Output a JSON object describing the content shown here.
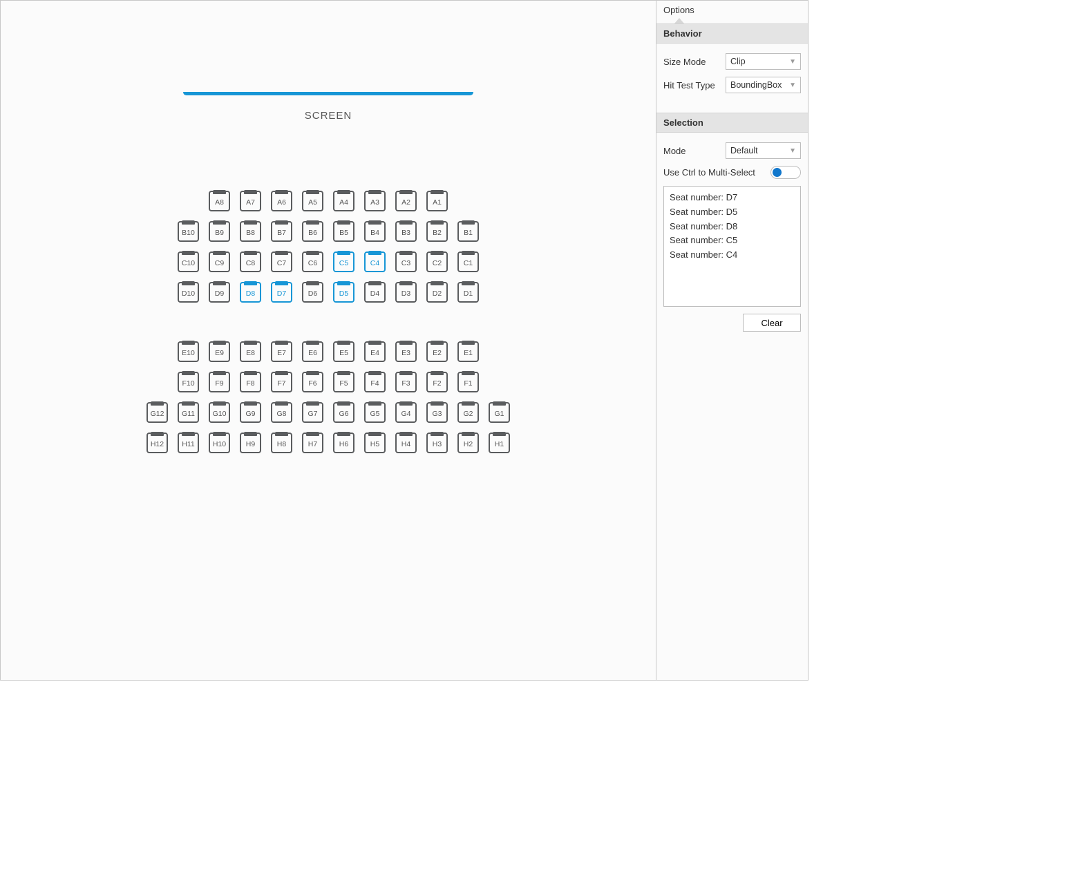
{
  "screen_label": "SCREEN",
  "rows": [
    {
      "seats": [
        "A8",
        "A7",
        "A6",
        "A5",
        "A4",
        "A3",
        "A2",
        "A1"
      ],
      "gap_before": false
    },
    {
      "seats": [
        "B10",
        "B9",
        "B8",
        "B7",
        "B6",
        "B5",
        "B4",
        "B3",
        "B2",
        "B1"
      ],
      "gap_before": false
    },
    {
      "seats": [
        "C10",
        "C9",
        "C8",
        "C7",
        "C6",
        "C5",
        "C4",
        "C3",
        "C2",
        "C1"
      ],
      "gap_before": false
    },
    {
      "seats": [
        "D10",
        "D9",
        "D8",
        "D7",
        "D6",
        "D5",
        "D4",
        "D3",
        "D2",
        "D1"
      ],
      "gap_before": false
    },
    {
      "seats": [
        "E10",
        "E9",
        "E8",
        "E7",
        "E6",
        "E5",
        "E4",
        "E3",
        "E2",
        "E1"
      ],
      "gap_before": true
    },
    {
      "seats": [
        "F10",
        "F9",
        "F8",
        "F7",
        "F6",
        "F5",
        "F4",
        "F3",
        "F2",
        "F1"
      ],
      "gap_before": false
    },
    {
      "seats": [
        "G12",
        "G11",
        "G10",
        "G9",
        "G8",
        "G7",
        "G6",
        "G5",
        "G4",
        "G3",
        "G2",
        "G1"
      ],
      "gap_before": false
    },
    {
      "seats": [
        "H12",
        "H11",
        "H10",
        "H9",
        "H8",
        "H7",
        "H6",
        "H5",
        "H4",
        "H3",
        "H2",
        "H1"
      ],
      "gap_before": false
    }
  ],
  "selected_seats": [
    "C5",
    "C4",
    "D8",
    "D7",
    "D5"
  ],
  "options": {
    "tab_label": "Options",
    "behavior": {
      "header": "Behavior",
      "size_mode_label": "Size Mode",
      "size_mode_value": "Clip",
      "hit_test_label": "Hit Test Type",
      "hit_test_value": "BoundingBox"
    },
    "selection": {
      "header": "Selection",
      "mode_label": "Mode",
      "mode_value": "Default",
      "multiselect_label": "Use Ctrl to Multi-Select",
      "multiselect_on": true,
      "list_prefix": "Seat number: ",
      "list_items": [
        "D7",
        "D5",
        "D8",
        "C5",
        "C4"
      ],
      "clear_button": "Clear"
    }
  }
}
